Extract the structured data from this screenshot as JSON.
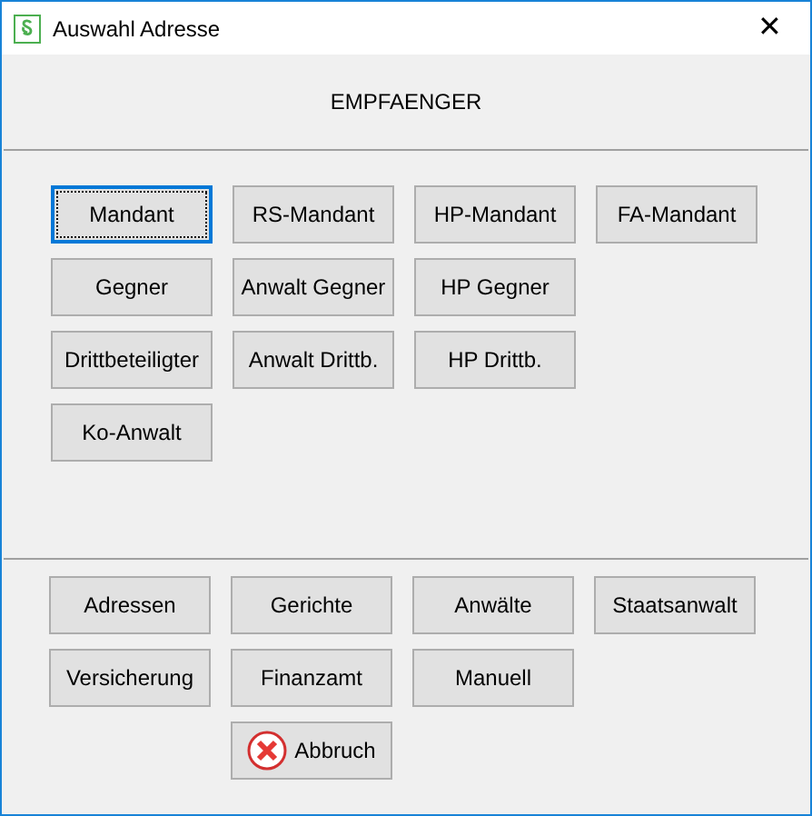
{
  "window": {
    "title": "Auswahl Adresse",
    "close": "✕"
  },
  "heading": "EMPFAENGER",
  "recipient_buttons": [
    [
      {
        "label": "Mandant",
        "focused": true
      },
      {
        "label": "RS-Mandant",
        "focused": false
      },
      {
        "label": "HP-Mandant",
        "focused": false
      },
      {
        "label": "FA-Mandant",
        "focused": false
      }
    ],
    [
      {
        "label": "Gegner",
        "focused": false
      },
      {
        "label": "Anwalt Gegner",
        "focused": false
      },
      {
        "label": "HP Gegner",
        "focused": false
      }
    ],
    [
      {
        "label": "Drittbeteiligter",
        "focused": false
      },
      {
        "label": "Anwalt Drittb.",
        "focused": false
      },
      {
        "label": "HP Drittb.",
        "focused": false
      }
    ],
    [
      {
        "label": "Ko-Anwalt",
        "focused": false
      }
    ]
  ],
  "source_buttons": [
    [
      {
        "label": "Adressen",
        "focused": false
      },
      {
        "label": "Gerichte",
        "focused": false
      },
      {
        "label": "Anwälte",
        "focused": false
      },
      {
        "label": "Staatsanwalt",
        "focused": false
      }
    ],
    [
      {
        "label": "Versicherung",
        "focused": false
      },
      {
        "label": "Finanzamt",
        "focused": false
      },
      {
        "label": "Manuell",
        "focused": false
      }
    ]
  ],
  "cancel_button": {
    "label": "Abbruch"
  }
}
